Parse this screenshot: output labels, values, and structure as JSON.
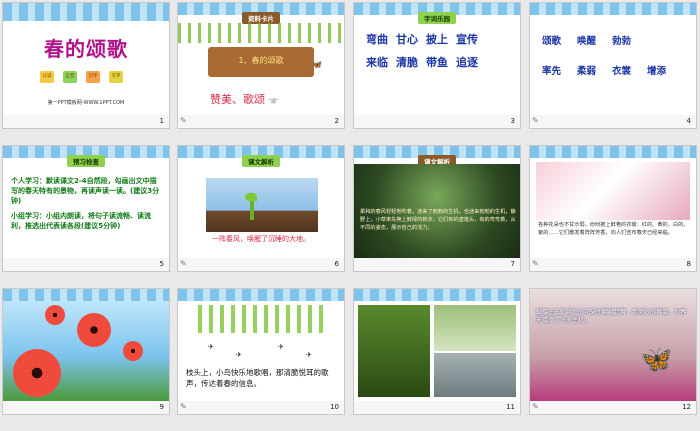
{
  "slides": [
    {
      "num": "1",
      "title": "春的颂歌",
      "chip_labels": [
        "认读",
        "正音",
        "识字",
        "写字"
      ],
      "footer_text": "第一PPT模板网-WWW.1PPT.COM"
    },
    {
      "num": "2",
      "chip": "资料卡片",
      "board": "1、春的颂歌",
      "sub_prefix": "赞美、歌颂",
      "sub_small": "“颂”"
    },
    {
      "num": "3",
      "chip": "字词乐园",
      "row1": [
        "弯曲",
        "甘心",
        "披上",
        "宣传"
      ],
      "row2": [
        "来临",
        "清脆",
        "带鱼",
        "追逐"
      ]
    },
    {
      "num": "4",
      "row1": [
        "颂歌",
        "唤醒",
        "勃勃"
      ],
      "row2": [
        "率先",
        "柔弱",
        "衣裳",
        "增添"
      ]
    },
    {
      "num": "5",
      "chip": "预习检查",
      "p1": "个人学习：默读课文2-4自然段，勾画出文中描写的春天特有的景物，再读声读一读。(建议3分钟)",
      "p2": "小组学习：小组内朗读，将句子读流畅、读流利，推选出代表读各段(建议5分钟)"
    },
    {
      "num": "6",
      "chip": "课文解析",
      "caption": "一阵春风，唤醒了沉睡的大地。"
    },
    {
      "num": "7",
      "chip": "课文解析",
      "text": "柔和的春风轻轻地吹着，迷来了勃勃的生机。也迷来勃勃的生机，静野上，小草率先换上鲜绿的新衣，它们有的虚落头，有的弯弯着，从不同的姿态，展示自己的活力。"
    },
    {
      "num": "8",
      "text": "各种花朵也不甘示弱，纷纷披上鲜艳的衣裳：红的、黄的、白的、紫的……它们散发着阵阵芳香，向人们宣布春天已经来临。"
    },
    {
      "num": "9"
    },
    {
      "num": "10",
      "text": "枝头上，小鸟快乐地歌唱，那清脆悦耳的歌声，传达着春的信息。"
    },
    {
      "num": "11"
    },
    {
      "num": "12",
      "text": "蝴蝶在五彩缤纷的花朵间翩翩起舞，那美妙的舞姿，为春天增添了许多生机。"
    }
  ]
}
